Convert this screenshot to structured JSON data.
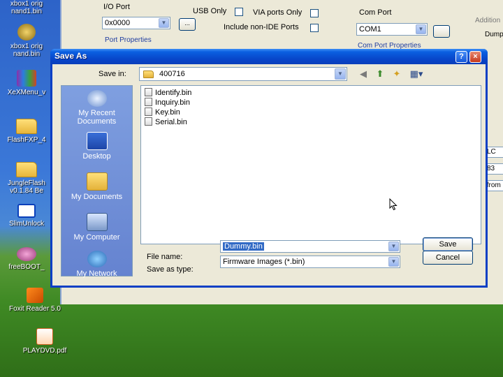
{
  "desktop": {
    "icons": [
      {
        "label": "xbox1 orig nand1.bin"
      },
      {
        "label": "xbox1 orig nand.bin"
      },
      {
        "label": "XeXMenu_v"
      },
      {
        "label": "FlashFXP_4"
      },
      {
        "label": "JungleFlash v0.1.84 Be"
      },
      {
        "label": "SlimUnlock"
      },
      {
        "label": "freeBOOT_"
      },
      {
        "label": "Foxit Reader 5.0"
      },
      {
        "label": "PLAYDVD.pdf"
      }
    ]
  },
  "app": {
    "io_port_label": "I/O Port",
    "io_port_value": "0x0000",
    "browse_btn": "...",
    "usb_only": "USB Only",
    "via_ports_only": "VIA ports Only",
    "include_non_ide": "Include non-IDE Ports",
    "com_port_label": "Com Port",
    "com_port_value": "COM1",
    "port_properties": "Port Properties",
    "com_port_properties": "Com Port Properties",
    "additional": "Addition",
    "dump": "Dump",
    "side_values": [
      "LC",
      "83",
      "y from"
    ]
  },
  "dialog": {
    "title": "Save As",
    "help": "?",
    "close": "×",
    "save_in_label": "Save in:",
    "save_in_value": "400716",
    "places": [
      {
        "label": "My Recent Documents"
      },
      {
        "label": "Desktop"
      },
      {
        "label": "My Documents"
      },
      {
        "label": "My Computer"
      },
      {
        "label": "My Network"
      }
    ],
    "files": [
      {
        "name": "Identify.bin"
      },
      {
        "name": "Inquiry.bin"
      },
      {
        "name": "Key.bin"
      },
      {
        "name": "Serial.bin"
      }
    ],
    "file_name_label": "File name:",
    "file_name_value": "Dummy.bin",
    "save_as_type_label": "Save as type:",
    "save_as_type_value": "Firmware Images (*.bin)",
    "save_button": "Save",
    "cancel_button": "Cancel"
  },
  "colors": {
    "title_bar": "#0a4fd6",
    "places_bar": "#7090da",
    "selection": "#316ac5"
  }
}
